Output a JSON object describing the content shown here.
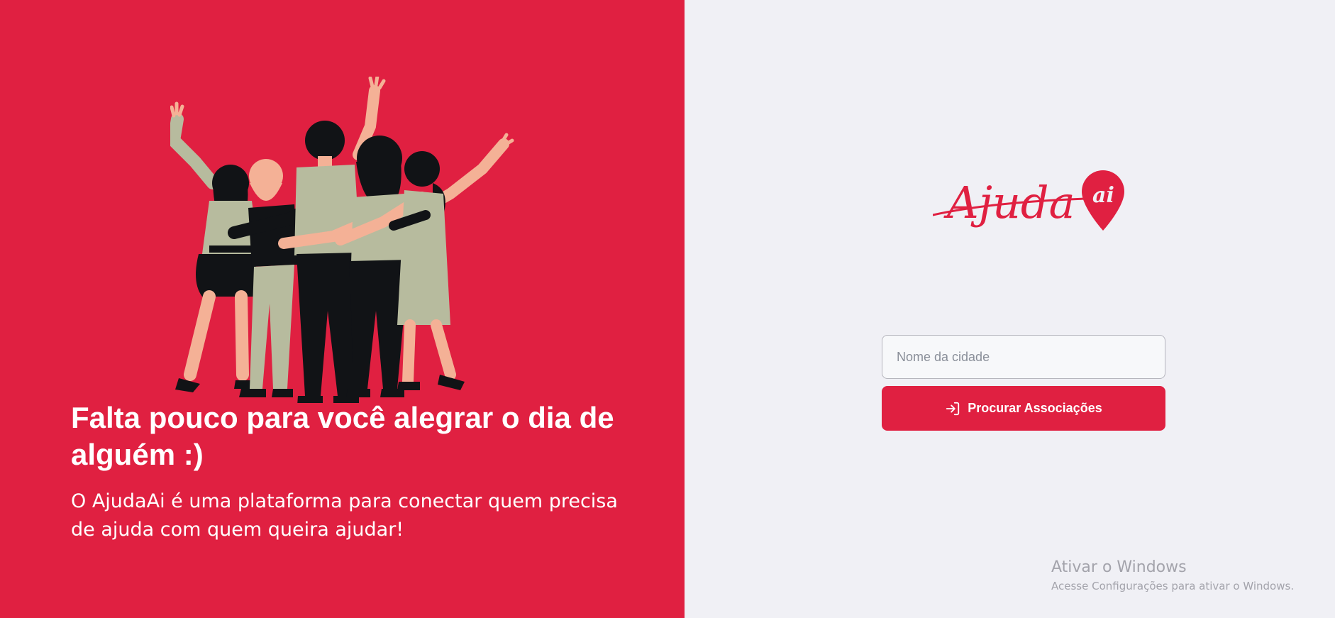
{
  "hero": {
    "headline": "Falta pouco para você alegrar o dia de alguém :)",
    "subtitle": "O AjudaAi é uma plataforma para conectar quem precisa de ajuda com quem queira ajudar!",
    "illustration_icon": "people-celebrating-illustration"
  },
  "logo": {
    "text_main": "Ajuda",
    "text_badge": "ai",
    "icon": "map-pin-icon"
  },
  "search": {
    "placeholder": "Nome da cidade",
    "value": "",
    "button_label": "Procurar Associações",
    "button_icon": "log-in-icon"
  },
  "windows_watermark": {
    "title": "Ativar o Windows",
    "subtitle": "Acesse Configurações para ativar o Windows."
  },
  "colors": {
    "brand_red": "#e02041",
    "background_light": "#f0f0f5",
    "skin": "#f4b196",
    "sage": "#b7bb9e",
    "dark": "#111316"
  }
}
